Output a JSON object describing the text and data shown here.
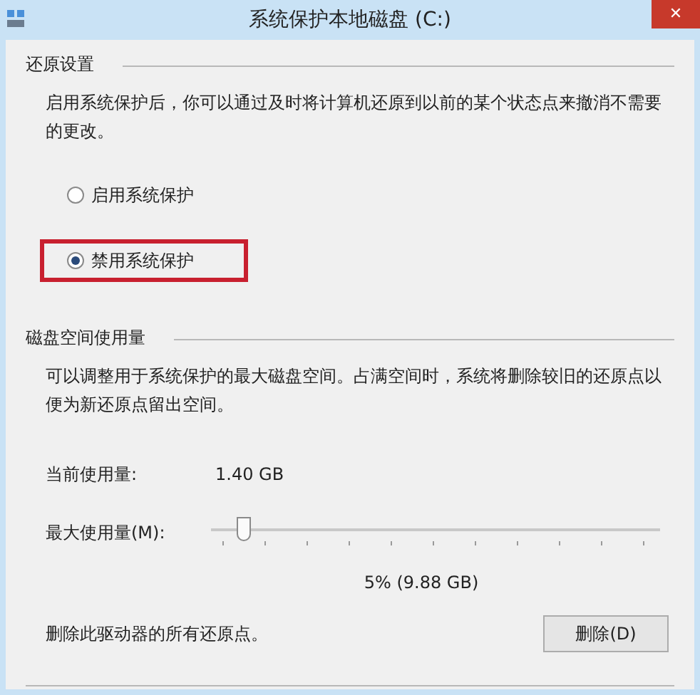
{
  "window": {
    "title": "系统保护本地磁盘 (C:)",
    "close": "✕"
  },
  "restore_settings": {
    "heading": "还原设置",
    "description": "启用系统保护后，你可以通过及时将计算机还原到以前的某个状态点来撤消不需要的更改。",
    "options": [
      {
        "label": "启用系统保护",
        "selected": false,
        "highlighted": false
      },
      {
        "label": "禁用系统保护",
        "selected": true,
        "highlighted": true
      }
    ]
  },
  "disk_usage": {
    "heading": "磁盘空间使用量",
    "description": "可以调整用于系统保护的最大磁盘空间。占满空间时，系统将删除较旧的还原点以便为新还原点留出空间。",
    "current_label": "当前使用量:",
    "current_value": "1.40 GB",
    "max_label": "最大使用量(M):",
    "max_slider": {
      "level": 0.05
    },
    "max_reading": "5% (9.88 GB)",
    "delete_text": "删除此驱动器的所有还原点。",
    "delete_button": "删除(D)"
  }
}
